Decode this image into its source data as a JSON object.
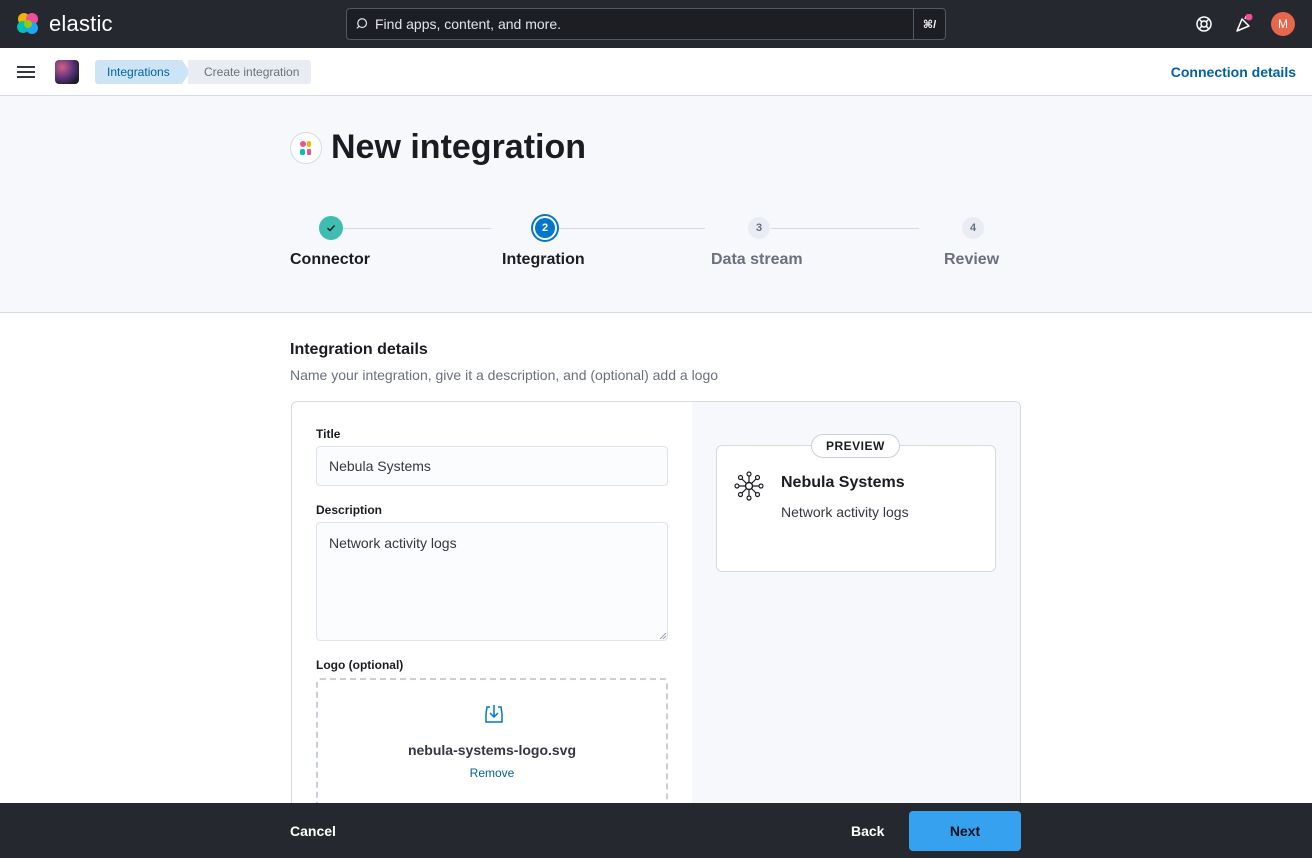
{
  "header": {
    "brand": "elastic",
    "search_placeholder": "Find apps, content, and more.",
    "search_shortcut": "⌘/",
    "user_initial": "M"
  },
  "breadcrumbs": [
    "Integrations",
    "Create integration"
  ],
  "connection_details_label": "Connection details",
  "page": {
    "title": "New integration"
  },
  "steps": [
    {
      "number": "",
      "label": "Connector",
      "status": "complete"
    },
    {
      "number": "2",
      "label": "Integration",
      "status": "current"
    },
    {
      "number": "3",
      "label": "Data stream",
      "status": "incomplete"
    },
    {
      "number": "4",
      "label": "Review",
      "status": "incomplete"
    }
  ],
  "form": {
    "section_title": "Integration details",
    "section_subtitle": "Name your integration, give it a description, and (optional) add a logo",
    "title_label": "Title",
    "title_value": "Nebula Systems",
    "description_label": "Description",
    "description_value": "Network activity logs",
    "logo_label": "Logo (optional)",
    "logo_filename": "nebula-systems-logo.svg",
    "logo_remove": "Remove"
  },
  "preview": {
    "badge": "PREVIEW",
    "title": "Nebula Systems",
    "description": "Network activity logs"
  },
  "footer": {
    "cancel": "Cancel",
    "back": "Back",
    "next": "Next"
  },
  "colors": {
    "header_bg": "#25282f",
    "link": "#0061a6",
    "step_complete": "#3ebeb0",
    "step_current": "#0077cc",
    "primary_button": "#36a2ef"
  }
}
